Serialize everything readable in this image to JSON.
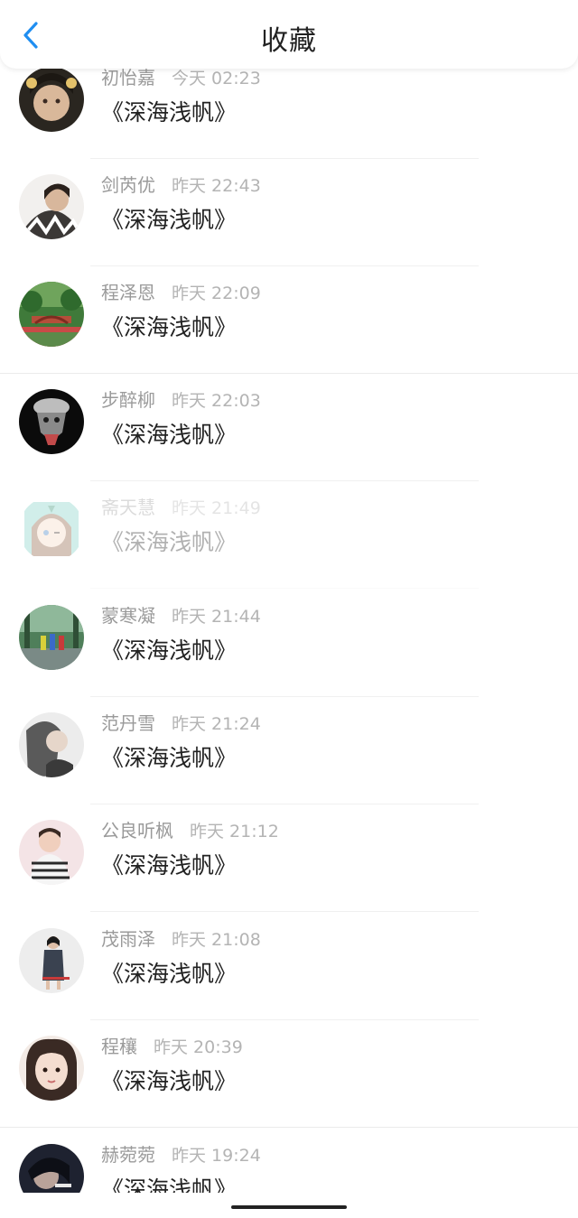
{
  "header": {
    "title": "收藏",
    "back_icon": "chevron-left-icon",
    "back_color": "#1f8ef1"
  },
  "items": [
    {
      "name": "初怡嘉",
      "time": "今天 02:23",
      "title": "《深海浅帆》"
    },
    {
      "name": "剑芮优",
      "time": "昨天 22:43",
      "title": "《深海浅帆》"
    },
    {
      "name": "程泽恩",
      "time": "昨天 22:09",
      "title": "《深海浅帆》"
    },
    {
      "name": "步醉柳",
      "time": "昨天 22:03",
      "title": "《深海浅帆》"
    },
    {
      "name": "斋天慧",
      "time": "昨天 21:49",
      "title": "《深海浅帆》"
    },
    {
      "name": "蒙寒凝",
      "time": "昨天 21:44",
      "title": "《深海浅帆》"
    },
    {
      "name": "范丹雪",
      "time": "昨天 21:24",
      "title": "《深海浅帆》"
    },
    {
      "name": "公良听枫",
      "time": "昨天 21:12",
      "title": "《深海浅帆》"
    },
    {
      "name": "茂雨泽",
      "time": "昨天 21:08",
      "title": "《深海浅帆》"
    },
    {
      "name": "程穰",
      "time": "昨天 20:39",
      "title": "《深海浅帆》"
    },
    {
      "name": "赫菀菀",
      "time": "昨天 19:24",
      "title": "《深海浅帆》"
    }
  ]
}
